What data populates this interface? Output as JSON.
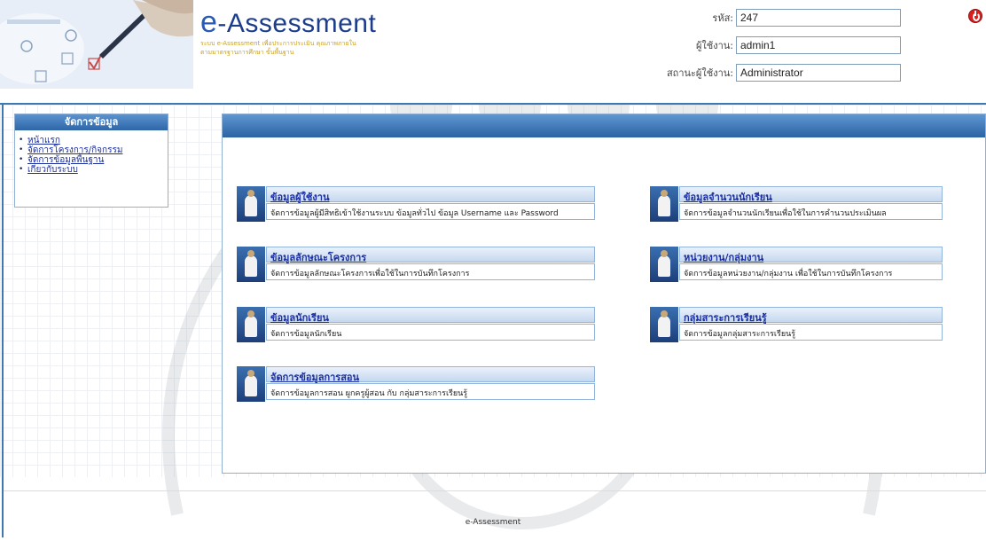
{
  "header": {
    "brand_e": "e",
    "brand_rest": "-Assessment",
    "subtitle": "ระบบ e-Assessment เพื่อประการประเมิน คุณภาพภายในตามมาตรฐานการศึกษา ขั้นพื้นฐาน"
  },
  "user_info": {
    "id_label": "รหัส:",
    "id_value": "247",
    "user_label": "ผู้ใช้งาน:",
    "user_value": "admin1",
    "status_label": "สถานะผู้ใช้งาน:",
    "status_value": "Administrator"
  },
  "sidebar": {
    "title": "จัดการข้อมูล",
    "items": [
      {
        "label": "หน้าแรก"
      },
      {
        "label": "จัดการโครงการ/กิจกรรม"
      },
      {
        "label": "จัดการข้อมูลพื้นฐาน"
      },
      {
        "label": "เกี่ยวกับระบบ"
      }
    ]
  },
  "cards": [
    {
      "title": "ข้อมูลผู้ใช้งาน",
      "desc": "จัดการข้อมูลผู้มีสิทธิเข้าใช้งานระบบ ข้อมูลทั่วไป ข้อมูล Username และ Password"
    },
    {
      "title": "ข้อมูลจำนวนนักเรียน",
      "desc": "จัดการข้อมูลจำนวนนักเรียนเพื่อใช้ในการคำนวนประเมินผล"
    },
    {
      "title": "ข้อมูลลักษณะโครงการ",
      "desc": "จัดการข้อมูลลักษณะโครงการเพื่อใช้ในการบันทึกโครงการ"
    },
    {
      "title": "หน่วยงาน/กลุ่มงาน",
      "desc": "จัดการข้อมูลหน่วยงาน/กลุ่มงาน เพื่อใช้ในการบันทึกโครงการ"
    },
    {
      "title": "ข้อมูลนักเรียน",
      "desc": "จัดการข้อมูลนักเรียน"
    },
    {
      "title": "กลุ่มสาระการเรียนรู้",
      "desc": "จัดการข้อมูลกลุ่มสาระการเรียนรู้"
    },
    {
      "title": "จัดการข้อมูลการสอน",
      "desc": "จัดการข้อมูลการสอน ผูกครูผู้สอน กับ กลุ่มสาระการเรียนรู้"
    }
  ],
  "footer": {
    "text": "e-Assessment"
  },
  "icons": {
    "logout": "power-icon",
    "card": "teacher-icon",
    "watermark": "university-seal-watermark"
  },
  "colors": {
    "accent": "#2b63a4",
    "link": "#1c2fa0",
    "logout": "#d62020"
  }
}
